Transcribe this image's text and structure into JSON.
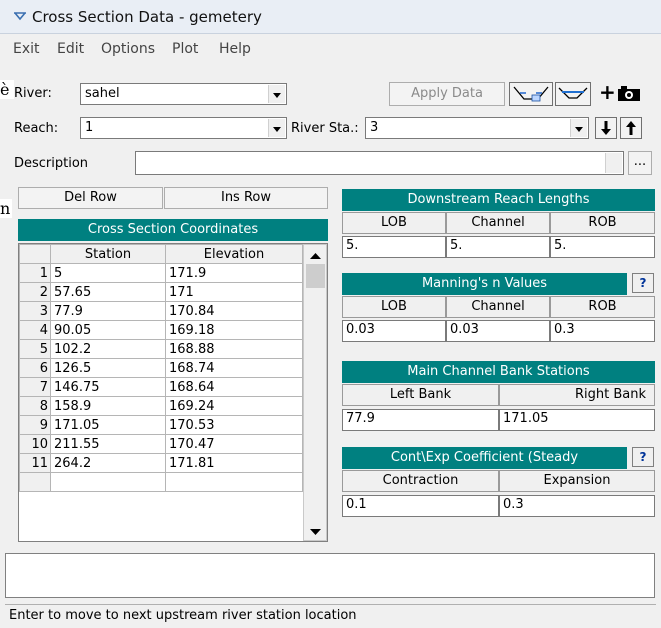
{
  "window": {
    "title": "Cross Section Data - gemetery"
  },
  "menu": {
    "items": [
      "Exit",
      "Edit",
      "Options",
      "Plot",
      "Help"
    ]
  },
  "background": {
    "text1": "è",
    "text2": "n"
  },
  "form": {
    "river_label": "River:",
    "river_value": "sahel",
    "apply_label": "Apply Data",
    "reach_label": "Reach:",
    "reach_value": "1",
    "river_sta_label": "River Sta.:",
    "river_sta_value": "3",
    "description_label": "Description",
    "description_value": "",
    "ellipsis_label": "..."
  },
  "toolbar": {
    "plus_label": "+",
    "icons": [
      "ineffective-flow-icon",
      "levee-icon",
      "add-photo-icon",
      "arrow-down-icon",
      "arrow-up-icon"
    ]
  },
  "coords": {
    "del_row_label": "Del Row",
    "ins_row_label": "Ins Row",
    "title": "Cross Section Coordinates",
    "col_station": "Station",
    "col_elevation": "Elevation",
    "rows": [
      {
        "n": "1",
        "station": "5",
        "elevation": "171.9"
      },
      {
        "n": "2",
        "station": "57.65",
        "elevation": "171"
      },
      {
        "n": "3",
        "station": "77.9",
        "elevation": "170.84"
      },
      {
        "n": "4",
        "station": "90.05",
        "elevation": "169.18"
      },
      {
        "n": "5",
        "station": "102.2",
        "elevation": "168.88"
      },
      {
        "n": "6",
        "station": "126.5",
        "elevation": "168.74"
      },
      {
        "n": "7",
        "station": "146.75",
        "elevation": "168.64"
      },
      {
        "n": "8",
        "station": "158.9",
        "elevation": "169.24"
      },
      {
        "n": "9",
        "station": "171.05",
        "elevation": "170.53"
      },
      {
        "n": "10",
        "station": "211.55",
        "elevation": "170.47"
      },
      {
        "n": "11",
        "station": "264.2",
        "elevation": "171.81"
      }
    ]
  },
  "downstream": {
    "title": "Downstream Reach Lengths",
    "col_lob": "LOB",
    "col_channel": "Channel",
    "col_rob": "ROB",
    "lob": "5.",
    "channel": "5.",
    "rob": "5."
  },
  "mannings": {
    "title": "Manning's n Values",
    "help": "?",
    "col_lob": "LOB",
    "col_channel": "Channel",
    "col_rob": "ROB",
    "lob": "0.03",
    "channel": "0.03",
    "rob": "0.3"
  },
  "bank": {
    "title": "Main Channel Bank Stations",
    "col_left": "Left Bank",
    "col_right": "Right Bank",
    "left": "77.9",
    "right": "171.05"
  },
  "coef": {
    "title": "Cont\\Exp Coefficient (Steady",
    "help": "?",
    "col_contraction": "Contraction",
    "col_expansion": "Expansion",
    "contraction": "0.1",
    "expansion": "0.3"
  },
  "status": {
    "text": "Enter to move to next upstream river station location"
  },
  "colors": {
    "teal": "#008080",
    "titlebar": "#e9eef5",
    "window": "#f0f0f0"
  }
}
